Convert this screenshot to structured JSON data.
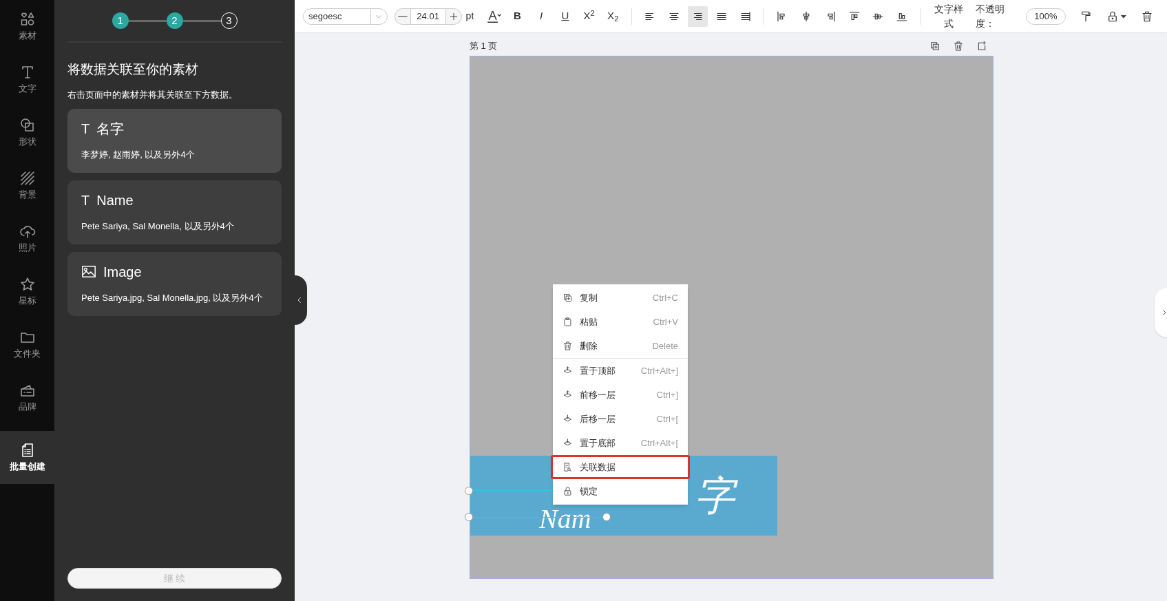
{
  "rail": [
    {
      "label": "素材",
      "selected": false
    },
    {
      "label": "文字",
      "selected": false
    },
    {
      "label": "形状",
      "selected": false
    },
    {
      "label": "背景",
      "selected": false
    },
    {
      "label": "照片",
      "selected": false
    },
    {
      "label": "星标",
      "selected": false
    },
    {
      "label": "文件夹",
      "selected": false
    },
    {
      "label": "品牌",
      "selected": false
    },
    {
      "label": "批量创建",
      "selected": true
    }
  ],
  "panel": {
    "steps": [
      {
        "label": "1",
        "done": true
      },
      {
        "label": "2",
        "done": true
      },
      {
        "label": "3",
        "done": false
      }
    ],
    "title": "将数据关联至你的素材",
    "subtitle": "右击页面中的素材并将其关联至下方数据。",
    "fields": [
      {
        "kind": "text",
        "icon_text": "T",
        "name": "名字",
        "values": "李梦婷, 赵雨婷, 以及另外4个"
      },
      {
        "kind": "text",
        "icon_text": "T",
        "name": "Name",
        "values": "Pete Sariya, Sal Monella, 以及另外4个"
      },
      {
        "kind": "image",
        "name": "Image",
        "values": "Pete Sariya.jpg, Sal Monella.jpg, 以及另外4个"
      }
    ],
    "continue_button": {
      "label": "继 续",
      "disabled": true
    }
  },
  "toolbar": {
    "font": "segoesc",
    "size": "24.01",
    "unit": "pt",
    "format_buttons": [
      "B",
      "I",
      "U",
      "X$^{2}$",
      "X$_{2}$"
    ],
    "align_buttons": [
      {
        "selected": false
      },
      {
        "selected": false
      },
      {
        "selected": true
      },
      {
        "selected": false
      },
      {
        "selected": false
      }
    ],
    "text_style": "文字样式",
    "opacity_label": "不透明度：",
    "opacity": "100%"
  },
  "page": {
    "label": "第 1 页",
    "banner_texts": [
      "Nam",
      "字"
    ]
  },
  "context_menu": [
    {
      "kind": "item",
      "label": "复制",
      "shortcut": "Ctrl+C",
      "highlighted": false
    },
    {
      "kind": "item",
      "label": "粘贴",
      "shortcut": "Ctrl+V",
      "highlighted": false
    },
    {
      "kind": "item",
      "label": "删除",
      "shortcut": "Delete",
      "highlighted": false
    },
    {
      "kind": "separator"
    },
    {
      "kind": "item",
      "label": "置于顶部",
      "shortcut": "Ctrl+Alt+]",
      "highlighted": false
    },
    {
      "kind": "item",
      "label": "前移一层",
      "shortcut": "Ctrl+]",
      "highlighted": false
    },
    {
      "kind": "item",
      "label": "后移一层",
      "shortcut": "Ctrl+[",
      "highlighted": false
    },
    {
      "kind": "item",
      "label": "置于底部",
      "shortcut": "Ctrl+Alt+[",
      "highlighted": false
    },
    {
      "kind": "item",
      "label": "关联数据",
      "highlighted": true
    },
    {
      "kind": "item",
      "label": "锁定",
      "highlighted": false
    }
  ]
}
